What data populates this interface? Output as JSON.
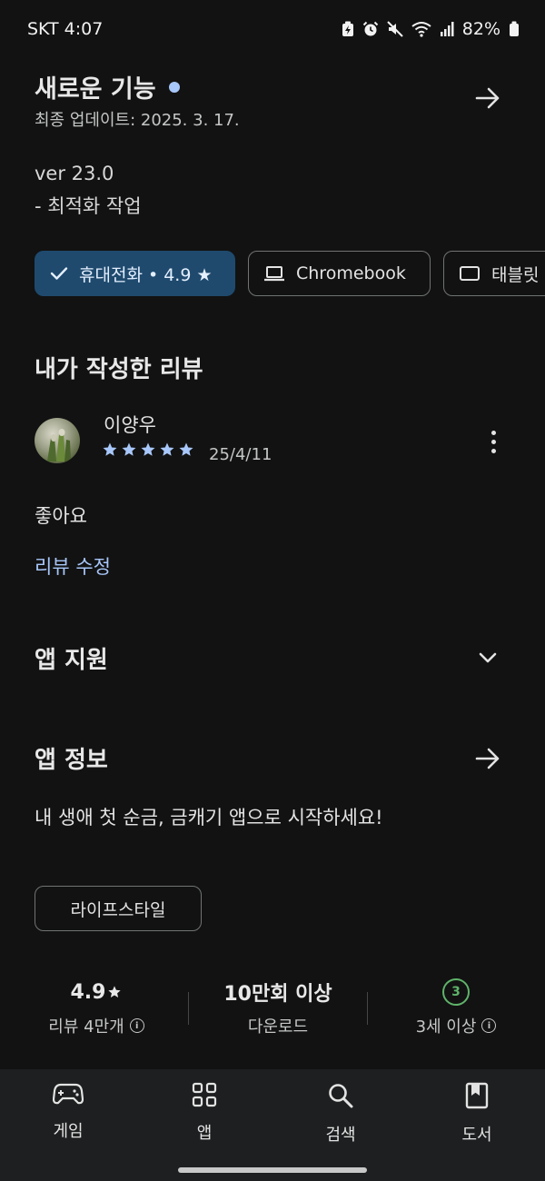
{
  "status_bar": {
    "carrier": "SKT",
    "time": "4:07",
    "battery": "82%"
  },
  "whats_new": {
    "title": "새로운 기능",
    "updated": "최종 업데이트: 2025. 3. 17.",
    "notes": [
      "ver 23.0",
      "- 최적화 작업"
    ]
  },
  "devices": {
    "phone": "휴대전화 • 4.9 ★",
    "chromebook": "Chromebook",
    "tablet": "태블릿"
  },
  "my_review": {
    "title": "내가 작성한 리뷰",
    "author": "이양우",
    "stars": 5,
    "date": "25/4/11",
    "text": "좋아요",
    "edit_label": "리뷰 수정"
  },
  "app_support": {
    "title": "앱 지원"
  },
  "app_info": {
    "title": "앱 정보",
    "description": "내 생애 첫 순금, 금캐기 앱으로 시작하세요!",
    "category": "라이프스타일"
  },
  "stats": {
    "rating": "4.9",
    "rating_label": "리뷰 4만개",
    "downloads": "10만회 이상",
    "downloads_label": "다운로드",
    "age_badge": "3",
    "age_label": "3세 이상"
  },
  "bottom_nav": {
    "games": "게임",
    "apps": "앱",
    "search": "검색",
    "books": "도서"
  },
  "colors": {
    "background": "#121212",
    "accent_blue": "#a8c7fa",
    "selected_chip": "#1f4a6e",
    "age_green": "#5fb36a"
  }
}
